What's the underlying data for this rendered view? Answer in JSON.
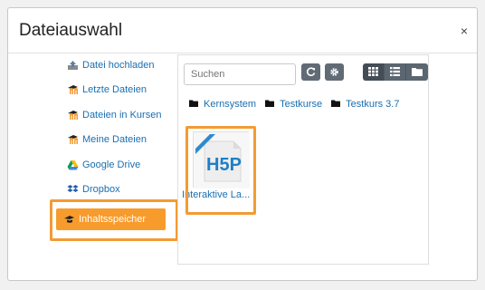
{
  "dialog": {
    "title": "Dateiauswahl",
    "close": "×"
  },
  "sidebar": {
    "items": [
      {
        "label": "Datei hochladen",
        "icon": "upload-icon"
      },
      {
        "label": "Letzte Dateien",
        "icon": "moodle-icon"
      },
      {
        "label": "Dateien in Kursen",
        "icon": "moodle-icon"
      },
      {
        "label": "Meine Dateien",
        "icon": "moodle-icon"
      },
      {
        "label": "Google Drive",
        "icon": "google-drive-icon"
      },
      {
        "label": "Dropbox",
        "icon": "dropbox-icon"
      },
      {
        "label": "Inhaltsspeicher",
        "icon": "content-bank-icon",
        "active": true
      }
    ]
  },
  "filepane": {
    "search_placeholder": "Suchen",
    "breadcrumb": [
      "Kernsystem",
      "Testkurse",
      "Testkurs 3.7"
    ],
    "files": [
      {
        "label": "Interaktive La...",
        "type": "H5P"
      }
    ]
  },
  "colors": {
    "accent": "#f89b2d",
    "highlight": "#f39b33",
    "link": "#1a6fb0",
    "button_dark": "#5b6670"
  }
}
